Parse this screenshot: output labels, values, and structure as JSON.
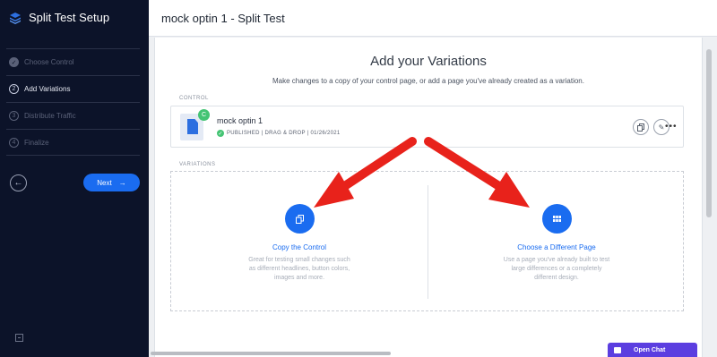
{
  "sidebar": {
    "title": "Split Test Setup",
    "logo_icon": "layers-icon",
    "steps": [
      {
        "number": "✓",
        "label": "Choose Control",
        "state": "done"
      },
      {
        "number": "2",
        "label": "Add Variations",
        "state": "active"
      },
      {
        "number": "3",
        "label": "Distribute Traffic",
        "state": "pending"
      },
      {
        "number": "4",
        "label": "Finalize",
        "state": "pending"
      }
    ],
    "back_icon": "arrow-left-icon",
    "next_label": "Next",
    "next_icon": "arrow-right-icon",
    "collapse_icon": "collapse-sidebar-icon"
  },
  "header": {
    "title": "mock optin 1 - Split Test"
  },
  "main": {
    "heading": "Add your Variations",
    "subheading": "Make changes to a copy of your control page, or add a page you've already created as a variation.",
    "control_label": "CONTROL",
    "control": {
      "badge": "C",
      "name": "mock optin 1",
      "meta": "PUBLISHED | DRAG & DROP | 01/26/2021"
    },
    "variations_label": "VARIATIONS",
    "options": [
      {
        "title": "Copy the Control",
        "description": "Great for testing small changes such as different headlines, button colors, images and more.",
        "icon": "copy-icon"
      },
      {
        "title": "Choose a Different Page",
        "description": "Use a page you've already built to test large differences or a completely different design.",
        "icon": "grid-icon"
      }
    ]
  },
  "chat": {
    "label": "Open Chat",
    "icon": "chat-icon"
  },
  "colors": {
    "sidebar_bg": "#0c1329",
    "accent": "#1a6cf0",
    "annotation_arrow": "#e8221b",
    "success": "#45c474",
    "chat": "#5b3ee0"
  }
}
